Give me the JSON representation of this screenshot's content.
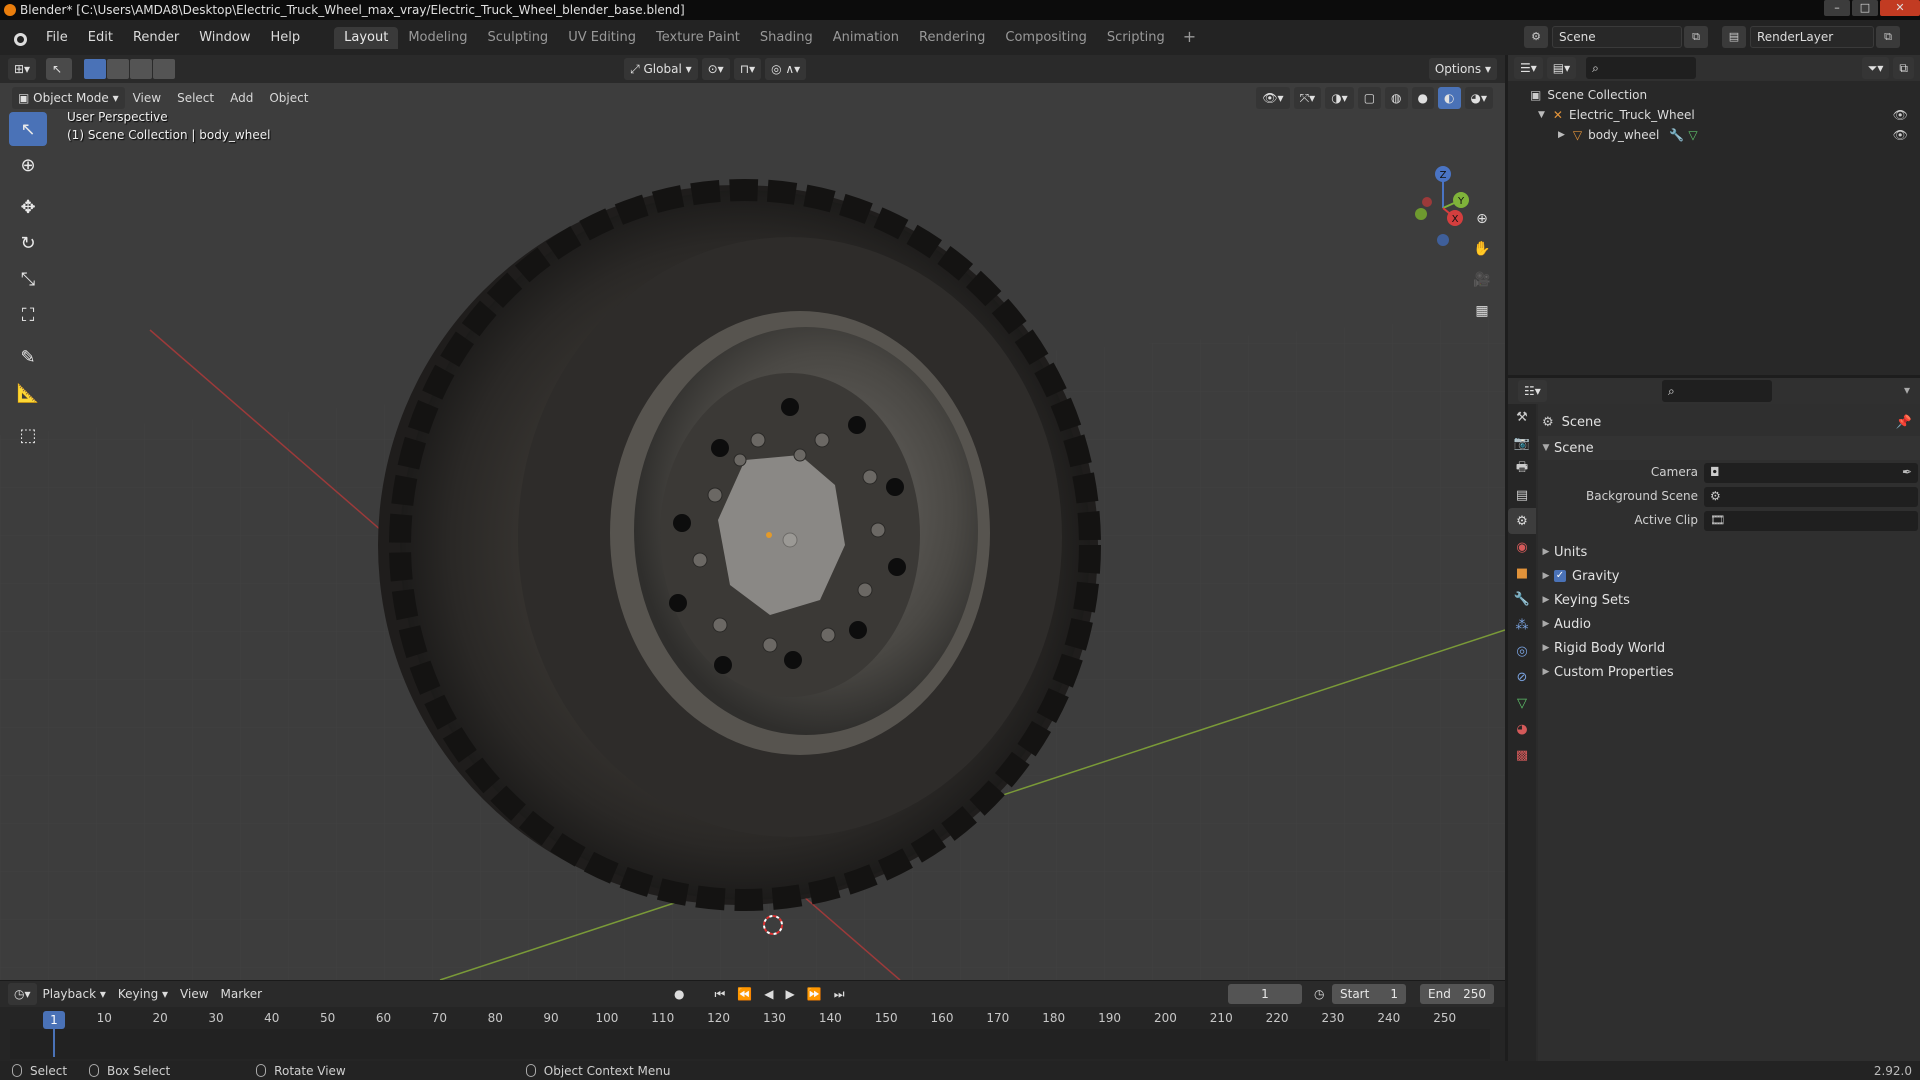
{
  "window": {
    "title": "Blender* [C:\\Users\\AMDA8\\Desktop\\Electric_Truck_Wheel_max_vray/Electric_Truck_Wheel_blender_base.blend]"
  },
  "menu": [
    "File",
    "Edit",
    "Render",
    "Window",
    "Help"
  ],
  "workspaces": [
    "Layout",
    "Modeling",
    "Sculpting",
    "UV Editing",
    "Texture Paint",
    "Shading",
    "Animation",
    "Rendering",
    "Compositing",
    "Scripting"
  ],
  "active_workspace": "Layout",
  "scene_name": "Scene",
  "view_layer": "RenderLayer",
  "viewport": {
    "mode": "Object Mode",
    "menus": [
      "View",
      "Select",
      "Add",
      "Object"
    ],
    "transform_orientation": "Global",
    "options_label": "Options",
    "overlay_line1": "User Perspective",
    "overlay_line2": "(1) Scene Collection | body_wheel",
    "gizmo_axes": [
      "Z",
      "Y",
      "X"
    ]
  },
  "timeline": {
    "menus": [
      "Playback",
      "Keying",
      "View",
      "Marker"
    ],
    "current_frame": "1",
    "start_label": "Start",
    "start_value": "1",
    "end_label": "End",
    "end_value": "250",
    "ruler_ticks": [
      "10",
      "20",
      "30",
      "40",
      "50",
      "60",
      "70",
      "80",
      "90",
      "100",
      "110",
      "120",
      "130",
      "140",
      "150",
      "160",
      "170",
      "180",
      "190",
      "200",
      "210",
      "220",
      "230",
      "240",
      "250"
    ],
    "ruler_current": "1"
  },
  "statusbar": {
    "select": "Select",
    "box_select": "Box Select",
    "rotate_view": "Rotate View",
    "context_menu": "Object Context Menu",
    "version": "2.92.0"
  },
  "outliner": {
    "root": "Scene Collection",
    "collection": "Electric_Truck_Wheel",
    "object": "body_wheel"
  },
  "properties": {
    "context_title": "Scene",
    "section_scene": "Scene",
    "camera_label": "Camera",
    "background_scene_label": "Background Scene",
    "active_clip_label": "Active Clip",
    "panels": [
      "Units",
      "Gravity",
      "Keying Sets",
      "Audio",
      "Rigid Body World",
      "Custom Properties"
    ],
    "gravity_checked": true
  },
  "colors": {
    "accent": "#4a72b7",
    "viewport_bg": "#3d3d3d",
    "axis_x": "#b83b3b",
    "axis_y": "#7fa23a"
  }
}
